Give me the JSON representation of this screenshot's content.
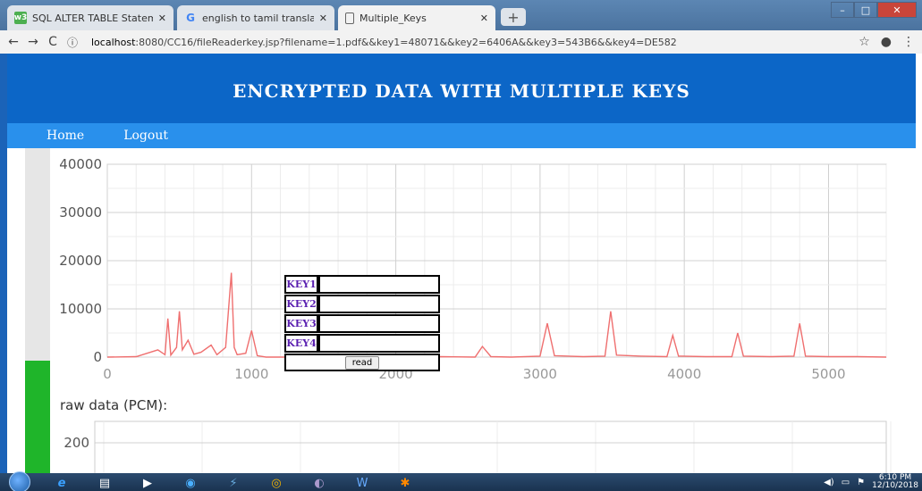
{
  "browser": {
    "tabs": [
      {
        "title": "SQL ALTER TABLE Statement",
        "icon": "w3schools-icon"
      },
      {
        "title": "english to tamil translation - Goo",
        "icon": "google-icon"
      },
      {
        "title": "Multiple_Keys",
        "icon": "page-icon"
      }
    ],
    "url_host": "localhost",
    "url_rest": ":8080/CC16/fileReaderkey.jsp?filename=1.pdf&&key1=48071&&key2=6406A&&key3=543B6&&key4=DE582"
  },
  "header": {
    "title": "ENCRYPTED DATA WITH MULTIPLE KEYS"
  },
  "nav": {
    "home": "Home",
    "logout": "Logout"
  },
  "key_form": {
    "labels": [
      "KEY1",
      "KEY2",
      "KEY3",
      "KEY4"
    ],
    "values": [
      "",
      "",
      "",
      ""
    ],
    "button": "read"
  },
  "pcm_label": "raw data (PCM):",
  "colors": {
    "header": "#0c66c7",
    "navbar": "#2990ec",
    "line": "#ef6f6f",
    "key_label": "#5a1fb0"
  },
  "chart_data": [
    {
      "type": "line",
      "xlim": [
        0,
        5400
      ],
      "ylim": [
        0,
        40000
      ],
      "yticks": [
        0,
        10000,
        20000,
        30000,
        40000
      ],
      "xticks": [
        0,
        1000,
        2000,
        3000,
        4000,
        5000
      ],
      "grid": true,
      "series": [
        {
          "x": [
            0,
            200,
            350,
            400,
            420,
            440,
            480,
            500,
            520,
            560,
            600,
            650,
            720,
            760,
            820,
            860,
            880,
            900,
            960,
            1000,
            1040,
            1060,
            1100,
            1400,
            1700,
            2000,
            2300,
            2550,
            2600,
            2660,
            2800,
            3000,
            3050,
            3100,
            3300,
            3450,
            3490,
            3530,
            3700,
            3880,
            3920,
            3960,
            4150,
            4330,
            4370,
            4410,
            4600,
            4760,
            4800,
            4840,
            5000,
            5200,
            5400
          ],
          "y": [
            0,
            100,
            1500,
            500,
            8000,
            400,
            2000,
            9500,
            1500,
            3500,
            600,
            1000,
            2500,
            500,
            2000,
            17500,
            2000,
            500,
            800,
            5500,
            300,
            200,
            0,
            0,
            0,
            0,
            100,
            0,
            2200,
            100,
            0,
            200,
            7000,
            300,
            100,
            200,
            9500,
            400,
            200,
            100,
            4500,
            200,
            100,
            100,
            5000,
            200,
            100,
            200,
            7000,
            200,
            100,
            100,
            0
          ]
        }
      ]
    },
    {
      "type": "line",
      "yticks": [
        200
      ],
      "grid": true
    }
  ]
}
